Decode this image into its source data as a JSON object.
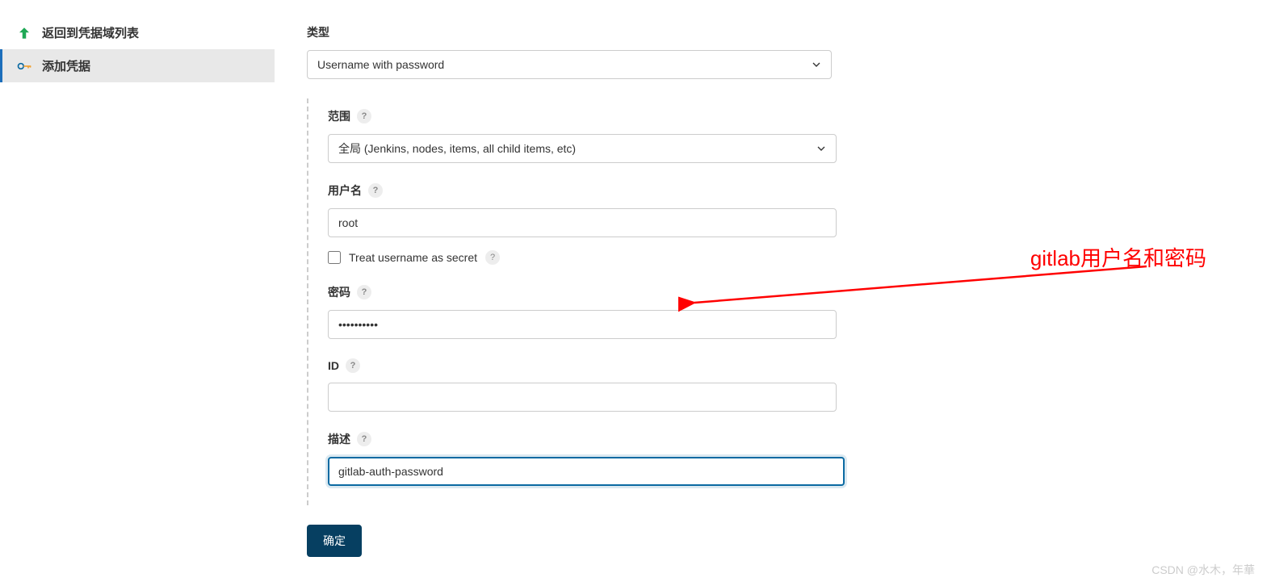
{
  "sidebar": {
    "items": [
      {
        "label": "返回到凭据域列表",
        "icon": "arrow-up"
      },
      {
        "label": "添加凭据",
        "icon": "key"
      }
    ]
  },
  "form": {
    "type_label": "类型",
    "type_value": "Username with password",
    "scope_label": "范围",
    "scope_value": "全局 (Jenkins, nodes, items, all child items, etc)",
    "username_label": "用户名",
    "username_value": "root",
    "treat_secret_label": "Treat username as secret",
    "password_label": "密码",
    "password_value": "••••••••••",
    "id_label": "ID",
    "id_value": "",
    "description_label": "描述",
    "description_value": "gitlab-auth-password",
    "submit_label": "确定"
  },
  "annotation": {
    "text": "gitlab用户名和密码"
  },
  "watermark": "CSDN @水木，年華"
}
